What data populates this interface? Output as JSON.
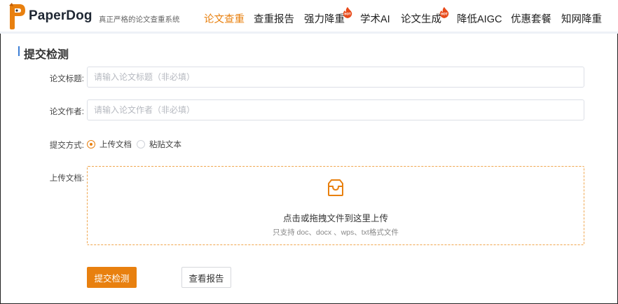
{
  "header": {
    "brand": "PaperDog",
    "slogan": "真正严格的论文查重系统",
    "nav": [
      {
        "label": "论文查重",
        "active": true,
        "hot": false
      },
      {
        "label": "查重报告",
        "active": false,
        "hot": false
      },
      {
        "label": "强力降重",
        "active": false,
        "hot": true
      },
      {
        "label": "学术AI",
        "active": false,
        "hot": false
      },
      {
        "label": "论文生成",
        "active": false,
        "hot": true
      },
      {
        "label": "降低AIGC",
        "active": false,
        "hot": false
      },
      {
        "label": "优惠套餐",
        "active": false,
        "hot": false
      },
      {
        "label": "知网降重",
        "active": false,
        "hot": false
      }
    ],
    "hot_badge": "HOT"
  },
  "page": {
    "section_title": "提交检测"
  },
  "form": {
    "title_label": "论文标题:",
    "title_placeholder": "请输入论文标题（非必填）",
    "title_value": "",
    "author_label": "论文作者:",
    "author_placeholder": "请输入论文作者（非必填）",
    "author_value": "",
    "method_label": "提交方式:",
    "method_options": [
      {
        "label": "上传文档",
        "checked": true
      },
      {
        "label": "粘贴文本",
        "checked": false
      }
    ],
    "upload_label": "上传文档:",
    "upload_main": "点击或拖拽文件到这里上传",
    "upload_sub": "只支持 doc、docx 、wps、txt格式文件"
  },
  "actions": {
    "submit_label": "提交检测",
    "report_label": "查看报告"
  },
  "colors": {
    "accent": "#e8800f",
    "section_bar": "#3d7fd6",
    "hot_badge": "#e84a1a"
  },
  "icons": {
    "logo": "paperdog-logo-icon",
    "upload": "inbox-icon",
    "hot": "flame-hot-icon"
  }
}
